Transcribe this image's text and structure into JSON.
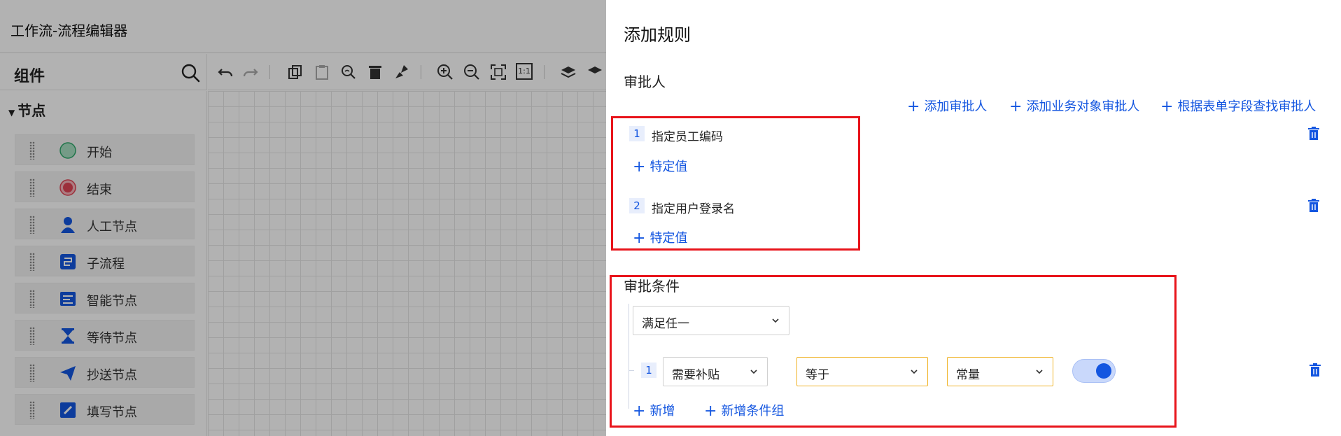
{
  "editor": {
    "app_title": "工作流-流程编辑器",
    "components_title": "组件",
    "section_label": "节点",
    "nodes": [
      {
        "label": "开始",
        "icon": "start-circle-icon"
      },
      {
        "label": "结束",
        "icon": "end-circle-icon"
      },
      {
        "label": "人工节点",
        "icon": "person-icon"
      },
      {
        "label": "子流程",
        "icon": "subprocess-icon"
      },
      {
        "label": "智能节点",
        "icon": "smart-node-icon"
      },
      {
        "label": "等待节点",
        "icon": "hourglass-icon"
      },
      {
        "label": "抄送节点",
        "icon": "send-icon"
      },
      {
        "label": "填写节点",
        "icon": "edit-icon"
      }
    ],
    "toolbar_tools": [
      "undo",
      "redo",
      "copy",
      "paste",
      "zoom-fit",
      "delete",
      "clear",
      "zoom-in",
      "zoom-out",
      "fit-screen",
      "actual-size",
      "layers"
    ],
    "toolbar_actual_size_text": "1:1"
  },
  "drawer": {
    "title": "添加规则",
    "approvers_heading": "审批人",
    "actions": {
      "add_approver": "添加审批人",
      "add_business_approver": "添加业务对象审批人",
      "find_by_form_field": "根据表单字段查找审批人"
    },
    "approvers": [
      {
        "index": "1",
        "label": "指定员工编码",
        "add_value": "特定值"
      },
      {
        "index": "2",
        "label": "指定用户登录名",
        "add_value": "特定值"
      }
    ],
    "conditions_heading": "审批条件",
    "match_mode": "满足任一",
    "condition": {
      "index": "1",
      "field": "需要补贴",
      "operator": "等于",
      "value_type": "常量",
      "toggle_on": true
    },
    "add_condition": "新增",
    "add_condition_group": "新增条件组"
  },
  "colors": {
    "link_blue": "#1456e0",
    "highlight_red": "#e8141b",
    "orange_border": "#f0b429"
  }
}
